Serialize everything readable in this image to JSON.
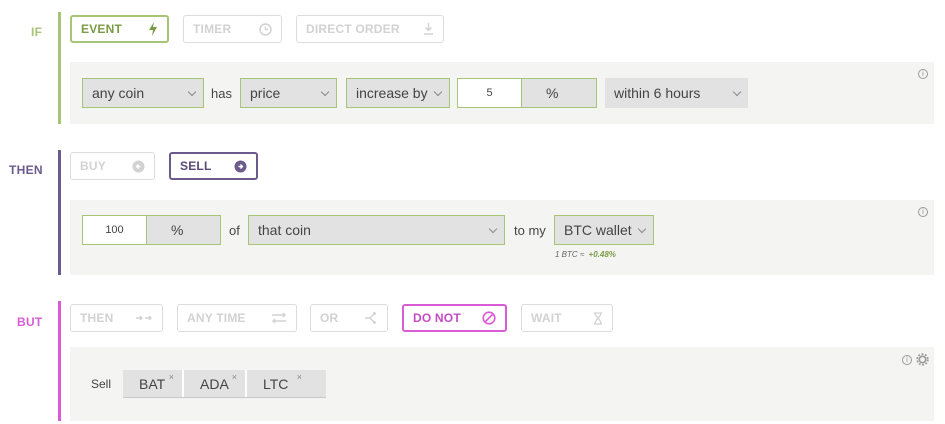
{
  "if_section": {
    "label": "IF",
    "color": "#a8c475",
    "tabs": [
      {
        "label": "EVENT",
        "icon": "bolt-icon",
        "glyph": "⚡",
        "active": true
      },
      {
        "label": "TIMER",
        "icon": "clock-icon",
        "glyph": "◷",
        "active": false
      },
      {
        "label": "DIRECT ORDER",
        "icon": "download-icon",
        "glyph": "⭳",
        "active": false
      }
    ],
    "condition": {
      "coin_select": "any coin",
      "has_label": "has",
      "metric_select": "price",
      "change_select": "increase by",
      "amount_value": "5",
      "unit_select": "%",
      "timeframe_select": "within 6 hours"
    }
  },
  "then_section": {
    "label": "THEN",
    "color": "#6d5a8c",
    "tabs": [
      {
        "label": "BUY",
        "icon": "arrow-circle-left-icon",
        "active": false
      },
      {
        "label": "SELL",
        "icon": "arrow-circle-right-icon",
        "active": true
      }
    ],
    "action": {
      "amount_value": "100",
      "unit_select": "%",
      "of_label": "of",
      "target_select": "that coin",
      "to_my_label": "to my",
      "wallet_select": "BTC wallet",
      "rate_prefix": "1 BTC ≈",
      "rate_change": "+0.48%"
    }
  },
  "but_section": {
    "label": "BUT",
    "color": "#d95cd6",
    "tabs": [
      {
        "label": "THEN",
        "icon": "then-arrows-icon",
        "glyph": "→→",
        "active": false
      },
      {
        "label": "ANY TIME",
        "icon": "swap-arrows-icon",
        "glyph": "⇄",
        "active": false
      },
      {
        "label": "OR",
        "icon": "branch-icon",
        "glyph": "⋊",
        "active": false
      },
      {
        "label": "DO NOT",
        "icon": "prohibited-icon",
        "glyph": "⊘",
        "active": true
      },
      {
        "label": "WAIT",
        "icon": "hourglass-icon",
        "glyph": "⧗",
        "active": false
      }
    ],
    "exception": {
      "sell_label": "Sell",
      "coins": [
        "BAT",
        "ADA",
        "LTC"
      ],
      "remove_glyph": "×"
    }
  },
  "info_glyph": "i"
}
